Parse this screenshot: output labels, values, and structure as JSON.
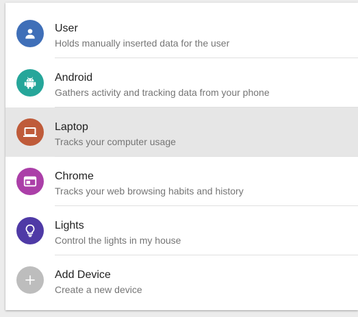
{
  "devices": [
    {
      "title": "User",
      "subtitle": "Holds manually inserted data for the user",
      "icon": "person-icon",
      "color": "#3f6fb8",
      "selected": false
    },
    {
      "title": "Android",
      "subtitle": "Gathers activity and tracking data from your phone",
      "icon": "android-icon",
      "color": "#26a69a",
      "selected": false
    },
    {
      "title": "Laptop",
      "subtitle": "Tracks your computer usage",
      "icon": "laptop-icon",
      "color": "#bf5b3a",
      "selected": true
    },
    {
      "title": "Chrome",
      "subtitle": "Tracks your web browsing habits and history",
      "icon": "browser-window-icon",
      "color": "#ab3fa8",
      "selected": false
    },
    {
      "title": "Lights",
      "subtitle": "Control the lights in my house",
      "icon": "lightbulb-icon",
      "color": "#4f3aa6",
      "selected": false
    },
    {
      "title": "Add Device",
      "subtitle": "Create a new device",
      "icon": "add-icon",
      "color": "#bdbdbd",
      "selected": false
    }
  ]
}
